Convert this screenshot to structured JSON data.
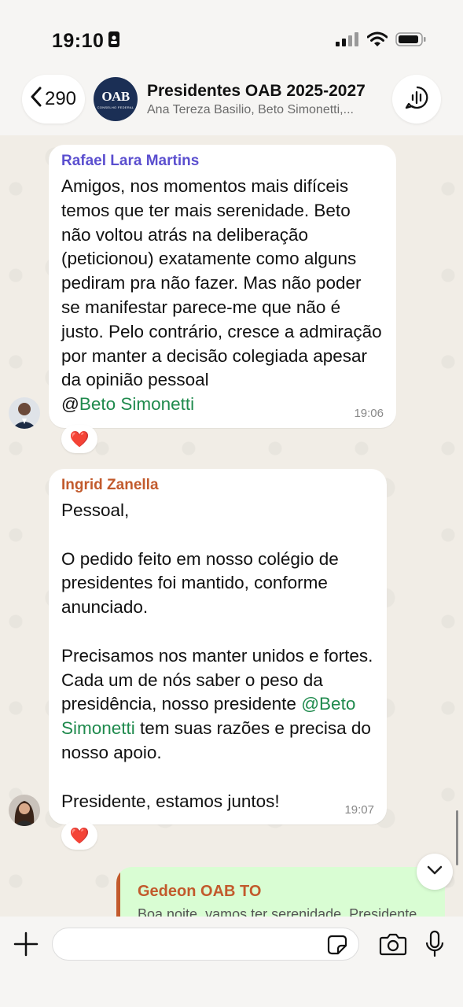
{
  "status_bar": {
    "time": "19:10"
  },
  "header": {
    "back_count": "290",
    "avatar_text": "OAB",
    "avatar_subtext": "CONSELHO FEDERAL",
    "title": "Presidentes OAB 2025-2027",
    "members": "Ana Tereza Basilio, Beto Simonetti,..."
  },
  "messages": [
    {
      "sender": "Rafael Lara Martins",
      "sender_color": "#5b4fcf",
      "text": "Amigos, nos momentos mais difíceis temos que ter mais serenidade. Beto não voltou atrás na deliberação (peticionou) exatamente como alguns pediram pra não fazer. Mas não poder se manifestar parece-me que não é justo. Pelo contrário, cresce a admiração por manter a decisão colegiada apesar da opinião pessoal",
      "mention_at": "@",
      "mention_name": "Beto Simonetti",
      "time": "19:06",
      "reaction": "❤️"
    },
    {
      "sender": "Ingrid Zanella",
      "sender_color": "#c25a2c",
      "text_1": "Pessoal,\n\nO pedido feito em nosso colégio de presidentes foi mantido, conforme anunciado.\n\nPrecisamos nos manter unidos e fortes. Cada um de nós saber o peso da presidência, nosso presidente ",
      "mention_at": "@",
      "mention_name": "Beto Simonetti",
      "text_2": " tem suas razões e precisa do nosso apoio.\n\nPresidente, estamos juntos!",
      "time": "19:07",
      "reaction": "❤️"
    }
  ],
  "outgoing_preview": {
    "quoted_sender": "Gedeon OAB TO",
    "quoted_text": "Boa noite, vamos ter serenidade. Presidente"
  },
  "input": {
    "placeholder": ""
  },
  "colors": {
    "mention": "#1f8a4d",
    "outgoing_bubble": "#d9fdd3",
    "background": "#efeae2"
  }
}
